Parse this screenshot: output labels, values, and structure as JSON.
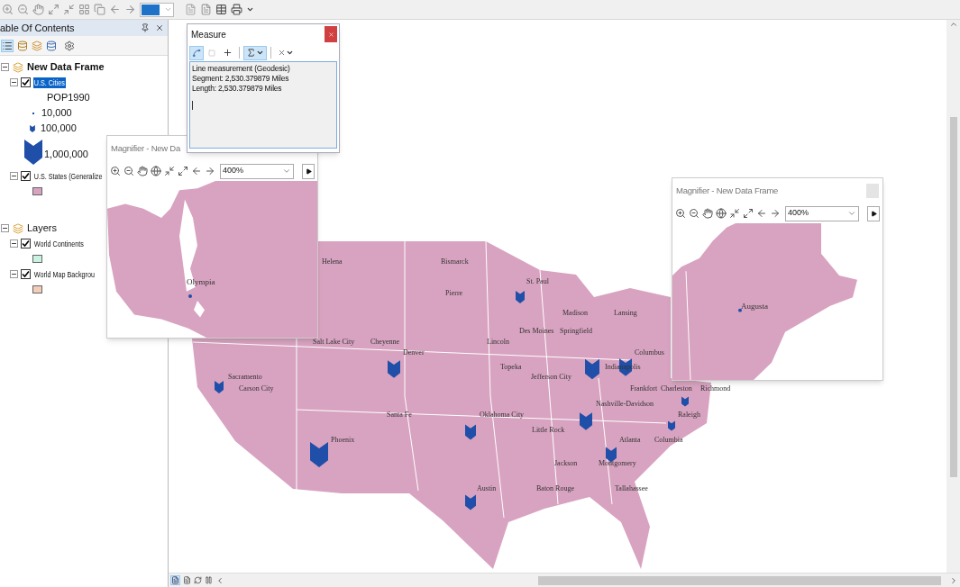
{
  "toc": {
    "title": "able Of Contents",
    "frames": [
      {
        "name": "New Data Frame",
        "expanded": true,
        "layers": [
          {
            "name": "U.S. Cities",
            "checked": true,
            "selected": true,
            "expanded": true,
            "legend": [
              {
                "kind": "heading",
                "label": "POP1990"
              },
              {
                "kind": "dot",
                "label": "10,000"
              },
              {
                "kind": "small-chevron",
                "label": "100,000"
              },
              {
                "kind": "large-chevron",
                "label": "1,000,000"
              }
            ]
          },
          {
            "name": "U.S. States (Generalize",
            "checked": true,
            "selected": false,
            "expanded": true,
            "legend": [
              {
                "kind": "swatch",
                "color": "#d8a3c0"
              }
            ]
          }
        ]
      },
      {
        "name": "Layers",
        "expanded": true,
        "layers": [
          {
            "name": "World Continents",
            "checked": true,
            "selected": false,
            "expanded": true,
            "legend": [
              {
                "kind": "swatch",
                "color": "#c9f2e2"
              }
            ]
          },
          {
            "name": "World Map Backgrou",
            "checked": true,
            "selected": false,
            "expanded": true,
            "legend": [
              {
                "kind": "swatch",
                "color": "#f2cdb8"
              }
            ]
          }
        ]
      }
    ]
  },
  "measure": {
    "title": "Measure",
    "tools": [
      {
        "kind": "line",
        "selected": true
      },
      {
        "kind": "area",
        "selected": false
      },
      {
        "kind": "feature",
        "selected": false
      },
      {
        "kind": "sum",
        "selected": true
      },
      {
        "kind": "clear",
        "selected": false
      }
    ],
    "lines": [
      "Line measurement (Geodesic)",
      "Segment: 2,530.379879 Miles",
      "Length: 2,530.379879 Miles"
    ]
  },
  "magnifiers": [
    {
      "title": "Magnifier - New Da",
      "zoom": "400%",
      "label": "Olympia"
    },
    {
      "title": "Magnifier - New Data Frame",
      "zoom": "400%",
      "label": "Augusta"
    }
  ],
  "map_labels": [
    "Helena",
    "Bismarck",
    "St. Paul",
    "Pierre",
    "Madison",
    "Lansing",
    "Des Moines",
    "Springfield",
    "Salt Lake City",
    "Cheyenne",
    "Lincoln",
    "Denver",
    "Columbus",
    "Topeka",
    "Indianapolis",
    "Sacramento",
    "Jefferson City",
    "Carson City",
    "Frankfort",
    "Charleston",
    "Richmond",
    "Nashville-Davidson",
    "Santa Fe",
    "Oklahoma City",
    "Raleigh",
    "Little Rock",
    "Phoenix",
    "Atlanta",
    "Columbia",
    "Jackson",
    "Montgomery",
    "Austin",
    "Baton Rouge",
    "Tallahassee"
  ]
}
